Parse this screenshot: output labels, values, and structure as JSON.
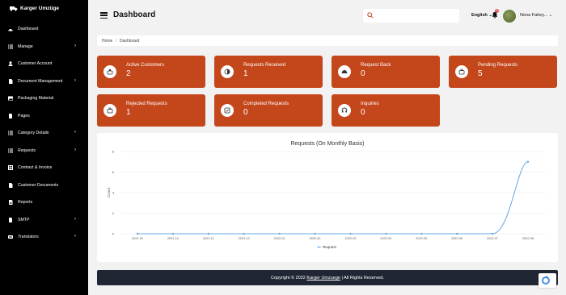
{
  "brand": {
    "name": "Karger Umzüge"
  },
  "sidebar": {
    "items": [
      {
        "label": "Dashboard",
        "icon": "dashboard-icon",
        "has_submenu": false
      },
      {
        "label": "Manage",
        "icon": "list-icon",
        "has_submenu": true
      },
      {
        "label": "Customer Account",
        "icon": "user-icon",
        "has_submenu": false
      },
      {
        "label": "Document Management",
        "icon": "document-icon",
        "has_submenu": true
      },
      {
        "label": "Packaging Material",
        "icon": "image-icon",
        "has_submenu": false
      },
      {
        "label": "Pages",
        "icon": "file-icon",
        "has_submenu": false
      },
      {
        "label": "Category Details",
        "icon": "list-icon",
        "has_submenu": true
      },
      {
        "label": "Requests",
        "icon": "list-icon",
        "has_submenu": true
      },
      {
        "label": "Contract & Invoice",
        "icon": "grid-icon",
        "has_submenu": false
      },
      {
        "label": "Customer Documents",
        "icon": "document-icon",
        "has_submenu": false
      },
      {
        "label": "Reports",
        "icon": "report-icon",
        "has_submenu": false
      },
      {
        "label": "SMTP",
        "icon": "file-icon",
        "has_submenu": true
      },
      {
        "label": "Translators",
        "icon": "translate-icon",
        "has_submenu": true
      }
    ],
    "chevron": "›"
  },
  "header": {
    "title": "Dashboard",
    "search_placeholder": "",
    "language": "English",
    "notification_count": "0",
    "user_name": "Nona Fahey...",
    "user_chevron": "⌄",
    "lang_chevron": "⌄"
  },
  "breadcrumb": {
    "home": "Home",
    "separator": "/",
    "current": "Dashboard"
  },
  "cards": [
    {
      "title": "Active Customers",
      "value": "2",
      "icon": "customers-icon"
    },
    {
      "title": "Requests Received",
      "value": "1",
      "icon": "received-icon"
    },
    {
      "title": "Request Back",
      "value": "0",
      "icon": "request-back-icon"
    },
    {
      "title": "Pending Requests",
      "value": "5",
      "icon": "pending-icon"
    },
    {
      "title": "Rejected Requests",
      "value": "1",
      "icon": "rejected-icon"
    },
    {
      "title": "Completed Requests",
      "value": "0",
      "icon": "completed-icon"
    },
    {
      "title": "Inquiries",
      "value": "0",
      "icon": "inquiries-icon"
    }
  ],
  "colors": {
    "card": "#c4461b",
    "sidebar": "#000000",
    "footer": "#202634",
    "line": "#64a8e6"
  },
  "chart_data": {
    "type": "line",
    "title": "Requests (On Monthly Basis)",
    "ylabel": "Count",
    "xlabel": "",
    "categories": [
      "2021-09",
      "2021-10",
      "2021-11",
      "2021-12",
      "2022-01",
      "2022-02",
      "2022-03",
      "2022-04",
      "2022-05",
      "2022-06",
      "2022-07",
      "2022-08"
    ],
    "yticks": [
      "0",
      "2",
      "4",
      "6",
      "8"
    ],
    "ylim": [
      0,
      8
    ],
    "series": [
      {
        "name": "Request",
        "values": [
          0,
          0,
          0,
          0,
          0,
          0,
          0,
          0,
          0,
          0,
          0,
          7
        ]
      }
    ],
    "legend": "bottom",
    "grid": true
  },
  "footer": {
    "prefix": "Copyright © 2022 ",
    "link": "Karger Umzuege",
    "suffix": " | All Rights Reserved."
  }
}
